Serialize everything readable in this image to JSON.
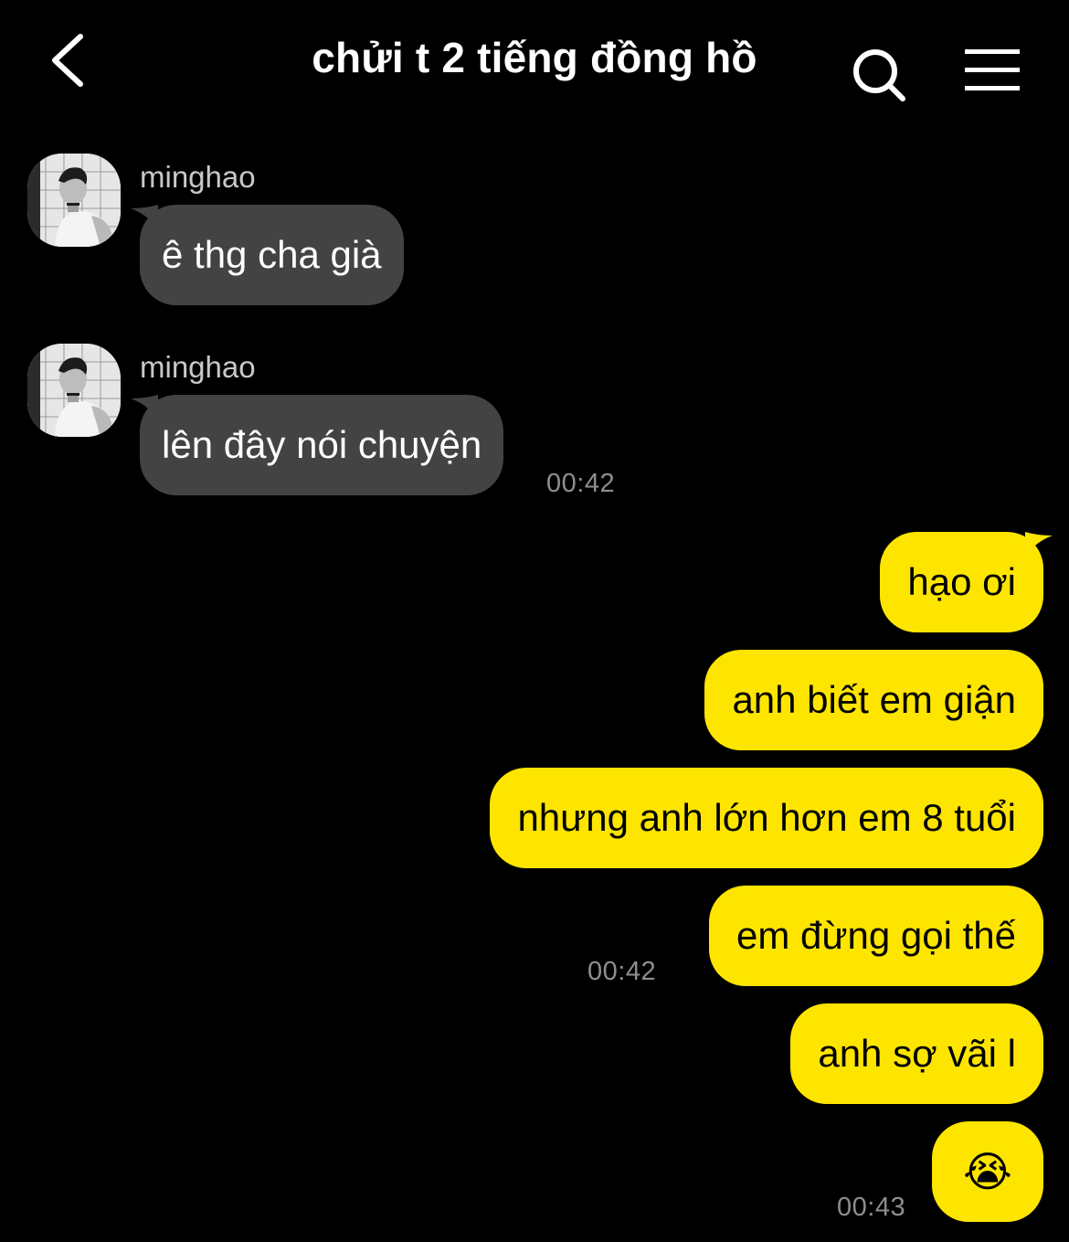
{
  "header": {
    "title": "chửi t 2 tiếng đồng hồ"
  },
  "messages": {
    "m1": {
      "sender": "minghao",
      "text": "ê thg cha già"
    },
    "m2": {
      "sender": "minghao",
      "text": "lên đây nói chuyện",
      "time": "00:42"
    },
    "m3": {
      "text": "hạo ơi"
    },
    "m4": {
      "text": "anh biết em giận"
    },
    "m5": {
      "text": "nhưng anh lớn hơn em 8 tuổi"
    },
    "m6": {
      "text": "em đừng gọi thế",
      "time": "00:42"
    },
    "m7": {
      "text": "anh sợ vãi l"
    },
    "m8": {
      "text": "😭",
      "time": "00:43"
    }
  },
  "colors": {
    "background": "#000000",
    "incoming_bubble": "#434343",
    "outgoing_bubble": "#fee500",
    "timestamp": "#8e8e8e",
    "sender_name": "#c8c8c8"
  },
  "icons": {
    "back": "chevron-left-icon",
    "search": "search-icon",
    "menu": "hamburger-menu-icon",
    "emoji": "loudly-crying-face"
  }
}
